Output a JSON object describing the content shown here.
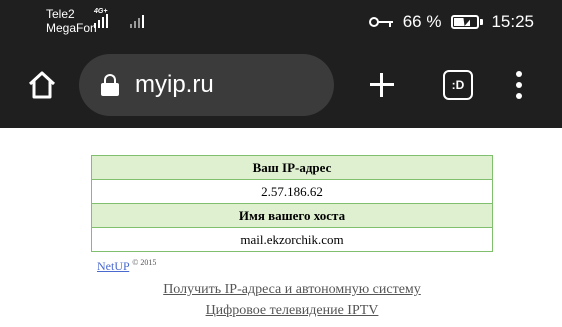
{
  "status_bar": {
    "carrier_1": "Tele2",
    "carrier_2": "MegaFon",
    "network_tag": "4G+",
    "battery": "66 %",
    "time": "15:25"
  },
  "toolbar": {
    "url": "myip.ru",
    "tabs_label": ":D"
  },
  "content": {
    "ip_header": "Ваш IP-адрес",
    "ip_value": "2.57.186.62",
    "host_header": "Имя вашего хоста",
    "host_value": "mail.ekzorchik.com",
    "netup_link": "NetUP",
    "netup_copy": "© 2015",
    "link_ip_as": "Получить IP-адреса и автономную систему",
    "link_iptv": "Цифровое телевидение IPTV"
  }
}
